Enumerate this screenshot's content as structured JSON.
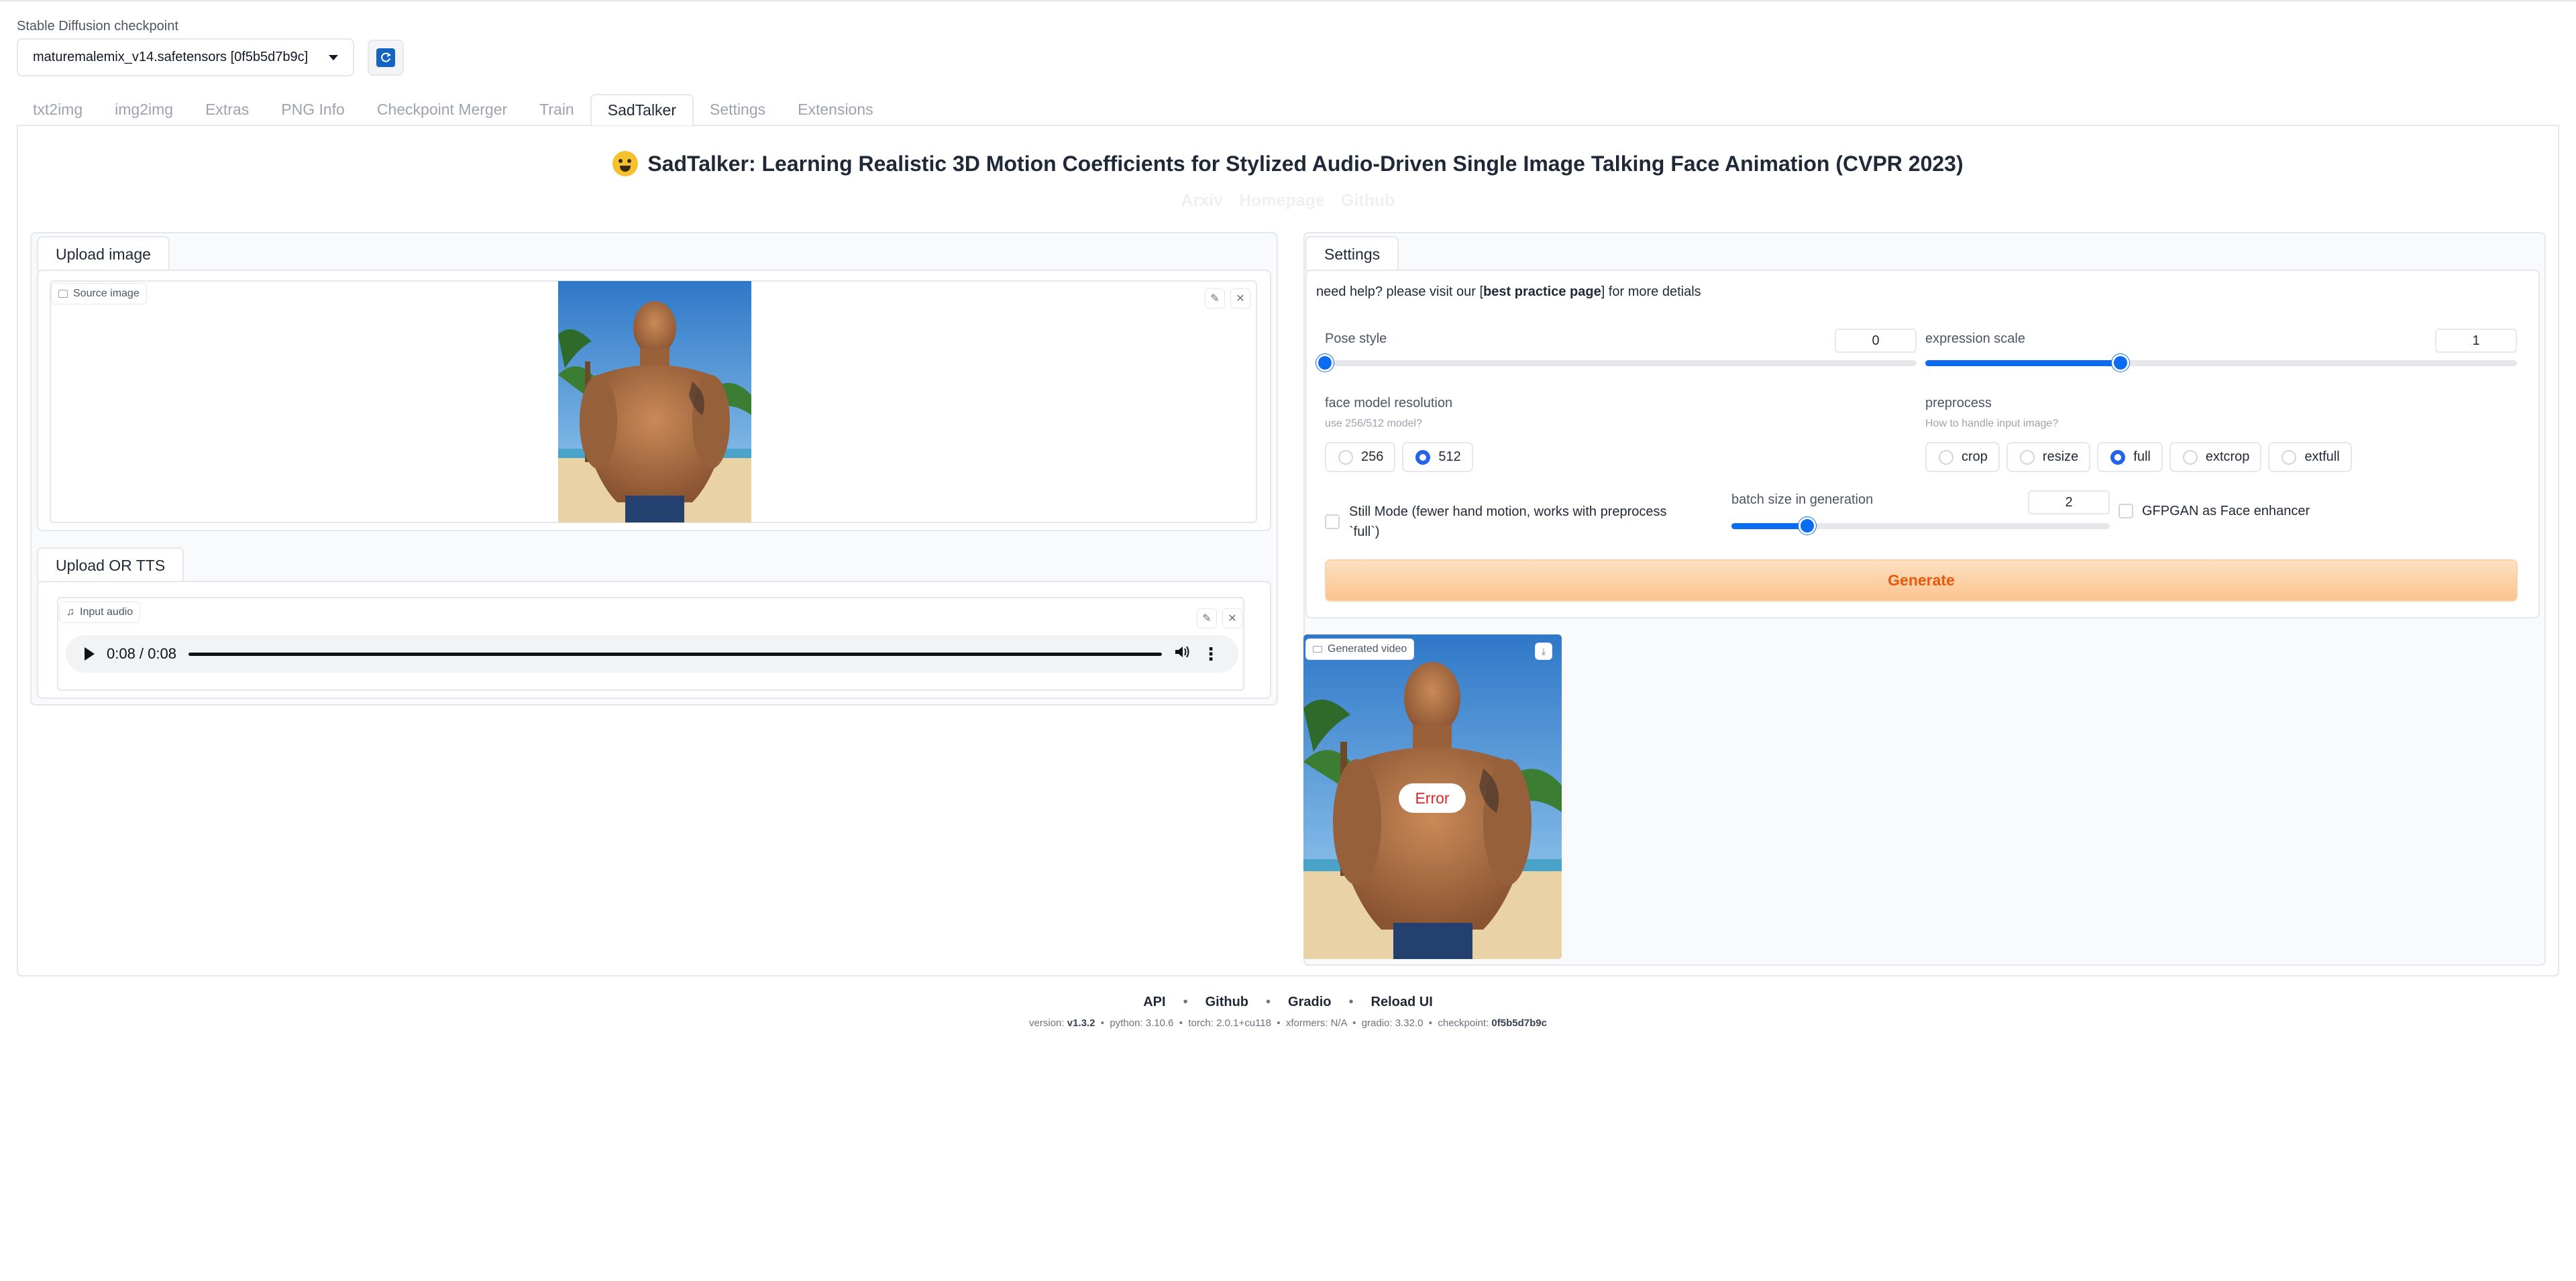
{
  "checkpoint": {
    "label": "Stable Diffusion checkpoint",
    "value": "maturemalemix_v14.safetensors [0f5b5d7b9c]"
  },
  "tabs": [
    "txt2img",
    "img2img",
    "Extras",
    "PNG Info",
    "Checkpoint Merger",
    "Train",
    "SadTalker",
    "Settings",
    "Extensions"
  ],
  "active_tab": "SadTalker",
  "header": {
    "title": "SadTalker: Learning Realistic 3D Motion Coefficients for Stylized Audio-Driven Single Image Talking Face Animation (CVPR 2023)",
    "links": [
      "Arxiv",
      "Homepage",
      "Github"
    ]
  },
  "upload_image": {
    "tab_label": "Upload image",
    "source_label": "Source image"
  },
  "upload_tts": {
    "tab_label": "Upload OR TTS",
    "audio_label": "Input audio",
    "time": "0:08 / 0:08",
    "progress": 1.0
  },
  "settings": {
    "tab_label": "Settings",
    "help_prefix": "need help? please visit our [",
    "help_link": "best practice page",
    "help_suffix": "] for more detials",
    "pose_style": {
      "label": "Pose style",
      "value": "0",
      "fraction": 0.0
    },
    "expression_scale": {
      "label": "expression scale",
      "value": "1",
      "fraction": 0.33
    },
    "face_model": {
      "label": "face model resolution",
      "sub": "use 256/512 model?",
      "options": [
        "256",
        "512"
      ],
      "selected": "512"
    },
    "preprocess": {
      "label": "preprocess",
      "sub": "How to handle input image?",
      "options": [
        "crop",
        "resize",
        "full",
        "extcrop",
        "extfull"
      ],
      "selected": "full"
    },
    "still_mode": {
      "label": "Still Mode (fewer hand motion, works with preprocess `full`)",
      "checked": false
    },
    "batch_size": {
      "label": "batch size in generation",
      "value": "2",
      "fraction": 0.2
    },
    "gfpgan": {
      "label": "GFPGAN as Face enhancer",
      "checked": false
    },
    "generate_label": "Generate"
  },
  "output": {
    "video_label": "Generated video",
    "error_text": "Error"
  },
  "footer": {
    "links": [
      "API",
      "Github",
      "Gradio",
      "Reload UI"
    ],
    "info": [
      {
        "key": "version:",
        "value": "v1.3.2",
        "bold": true
      },
      {
        "key": "python:",
        "value": "3.10.6",
        "bold": false
      },
      {
        "key": "torch:",
        "value": "2.0.1+cu118",
        "bold": false
      },
      {
        "key": "xformers:",
        "value": "N/A",
        "bold": false
      },
      {
        "key": "gradio:",
        "value": "3.32.0",
        "bold": false
      },
      {
        "key": "checkpoint:",
        "value": "0f5b5d7b9c",
        "bold": true
      }
    ]
  },
  "colors": {
    "accent": "#0b6cf2",
    "generate_text": "#ea580c",
    "error": "#dc2626"
  }
}
